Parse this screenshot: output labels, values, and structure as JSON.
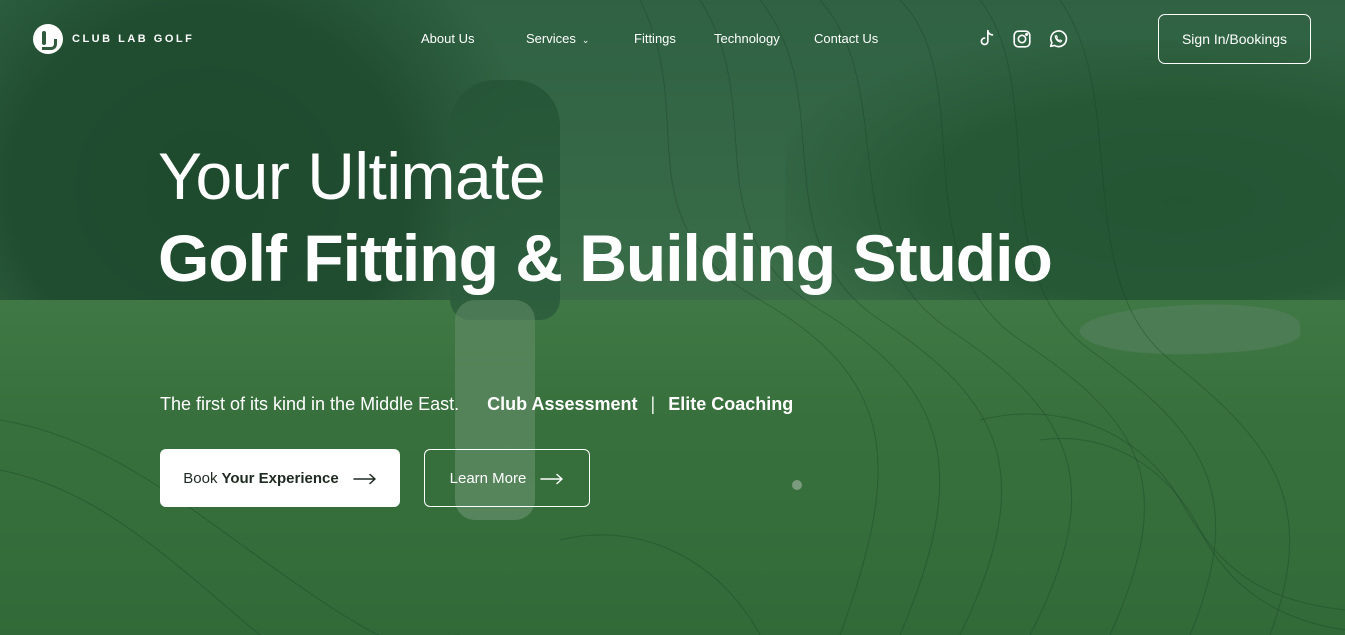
{
  "brand": {
    "name": "CLUB LAB GOLF"
  },
  "nav": {
    "items": [
      {
        "label": "About Us"
      },
      {
        "label": "Services",
        "has_dropdown": true
      },
      {
        "label": "Fittings"
      },
      {
        "label": "Technology"
      },
      {
        "label": "Contact Us"
      }
    ],
    "dropdown_icon": "chevron-down-icon"
  },
  "social": [
    {
      "icon": "tiktok-icon"
    },
    {
      "icon": "instagram-icon"
    },
    {
      "icon": "whatsapp-icon"
    }
  ],
  "header": {
    "signin_label": "Sign In/Bookings"
  },
  "hero": {
    "title_line1": "Your Ultimate",
    "title_line2": "Golf Fitting & Building Studio",
    "tagline_text": "The first of its kind in the Middle East.",
    "highlight_1": "Club Assessment",
    "separator": "|",
    "highlight_2": "Elite Coaching",
    "cta_primary_prefix": "Book",
    "cta_primary_bold": "Your Experience",
    "cta_secondary": "Learn More",
    "arrow_icon": "arrow-right-icon"
  },
  "colors": {
    "overlay_green": "#1c502c",
    "primary_button_bg": "#ffffff",
    "text": "#ffffff"
  }
}
